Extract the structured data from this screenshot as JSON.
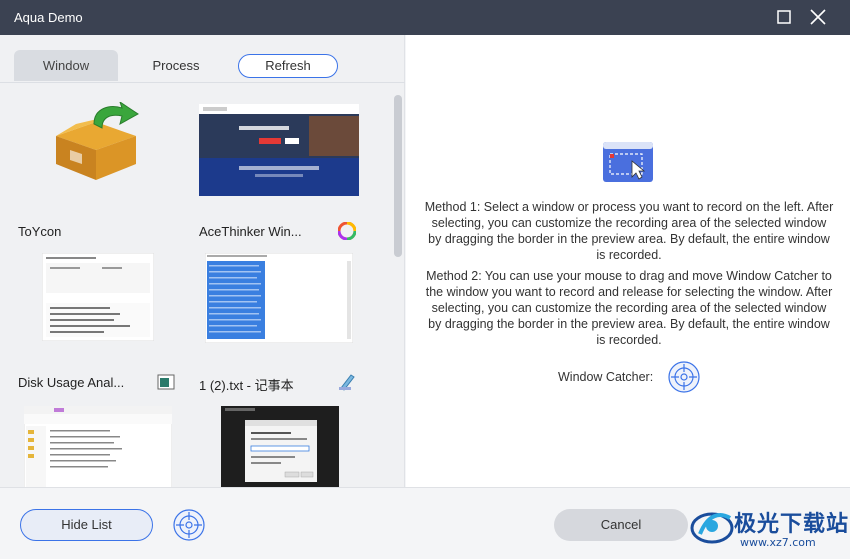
{
  "window": {
    "title": "Aqua Demo"
  },
  "tabs": {
    "window": "Window",
    "process": "Process",
    "refresh": "Refresh"
  },
  "items": [
    {
      "label": "ToYcon",
      "icon": "box-icon"
    },
    {
      "label": "AceThinker Win...",
      "icon": "acethinker-icon"
    },
    {
      "label": "Disk Usage Anal...",
      "icon": "disk-usage-icon"
    },
    {
      "label": "1 (2).txt - 记事本",
      "icon": "notepad-icon"
    },
    {
      "label": "",
      "icon": "explorer-thumb"
    },
    {
      "label": "",
      "icon": "dialog-thumb"
    }
  ],
  "right": {
    "method1": "Method 1: Select a window or process you want to record on the left. After selecting, you can customize the recording area of the selected window by dragging the border in the preview area. By default, the entire window is recorded.",
    "method2": "Method 2: You can use your mouse to drag and move Window Catcher to the window you want to record and release for selecting the window. After selecting, you can customize the recording area of the selected window by dragging the border in the preview area. By default, the entire window is recorded.",
    "catcher_label": "Window Catcher:"
  },
  "footer": {
    "hide_list": "Hide List",
    "cancel": "Cancel"
  },
  "watermark": {
    "text": "极光下载站",
    "url": "www.xz7.com"
  },
  "colors": {
    "titlebar": "#3b4252",
    "accent": "#3b73e8"
  }
}
